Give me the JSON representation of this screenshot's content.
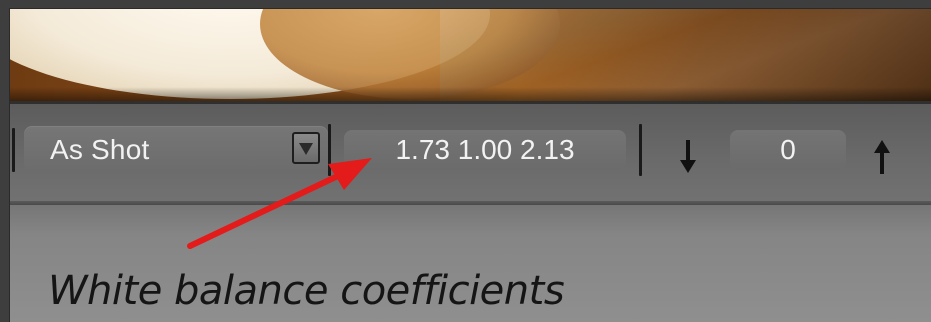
{
  "white_balance": {
    "preset_value": "As Shot",
    "coefficients_value": "1.73 1.00 2.13",
    "offset_value": "0"
  },
  "icons": {
    "dropdown": "chevron-down-icon",
    "decrease": "arrow-down-icon",
    "increase": "arrow-up-icon"
  },
  "annotation": {
    "caption": "White balance coefficients",
    "arrow_color": "#e31b1b"
  }
}
